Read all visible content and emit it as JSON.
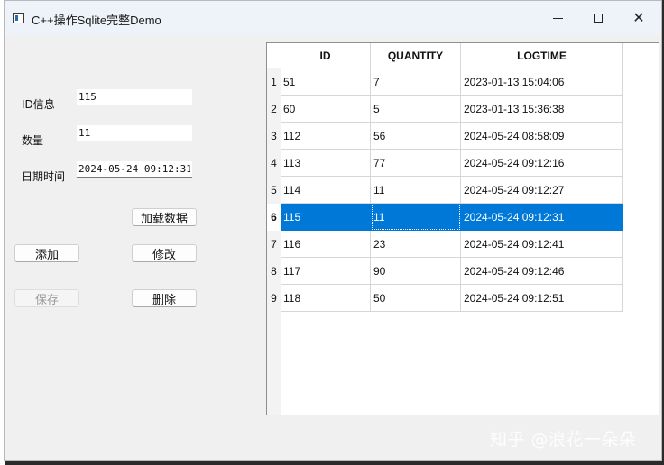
{
  "window": {
    "title": "C++操作Sqlite完整Demo",
    "controls": {
      "minimize_icon": "minimize-icon",
      "maximize_icon": "maximize-icon",
      "close_icon": "close-icon",
      "close_glyph": "✕"
    }
  },
  "form": {
    "id_label": "ID信息",
    "id_value": "115",
    "quantity_label": "数量",
    "quantity_value": "11",
    "datetime_label": "日期时间",
    "datetime_value": "2024-05-24 09:12:31"
  },
  "buttons": {
    "load": "加载数据",
    "add": "添加",
    "edit": "修改",
    "save": "保存",
    "delete": "删除"
  },
  "table": {
    "columns": [
      "ID",
      "QUANTITY",
      "LOGTIME"
    ],
    "selected_row": 6,
    "rows": [
      {
        "num": "1",
        "id": "51",
        "quantity": "7",
        "logtime": "2023-01-13 15:04:06"
      },
      {
        "num": "2",
        "id": "60",
        "quantity": "5",
        "logtime": "2023-01-13 15:36:38"
      },
      {
        "num": "3",
        "id": "112",
        "quantity": "56",
        "logtime": "2024-05-24 08:58:09"
      },
      {
        "num": "4",
        "id": "113",
        "quantity": "77",
        "logtime": "2024-05-24 09:12:16"
      },
      {
        "num": "5",
        "id": "114",
        "quantity": "11",
        "logtime": "2024-05-24 09:12:27"
      },
      {
        "num": "6",
        "id": "115",
        "quantity": "11",
        "logtime": "2024-05-24 09:12:31"
      },
      {
        "num": "7",
        "id": "116",
        "quantity": "23",
        "logtime": "2024-05-24 09:12:41"
      },
      {
        "num": "8",
        "id": "117",
        "quantity": "90",
        "logtime": "2024-05-24 09:12:46"
      },
      {
        "num": "9",
        "id": "118",
        "quantity": "50",
        "logtime": "2024-05-24 09:12:51"
      }
    ]
  },
  "watermark": "知乎 @浪花一朵朵",
  "colors": {
    "selection": "#0078d7",
    "window_bg": "#f0f0f0",
    "titlebar": "#eef3fa"
  }
}
